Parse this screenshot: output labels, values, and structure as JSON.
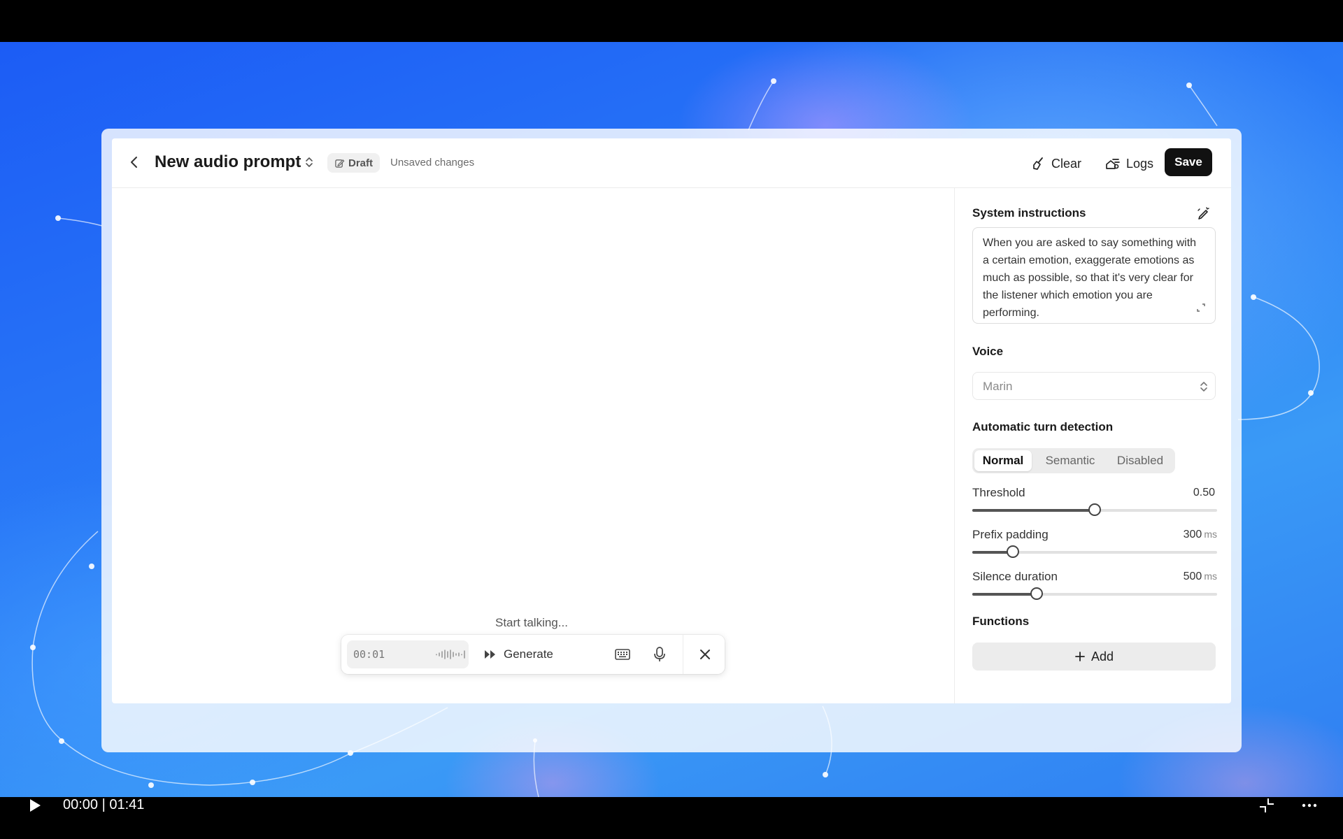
{
  "header": {
    "title": "New audio prompt",
    "draft_label": "Draft",
    "status_text": "Unsaved changes",
    "clear_label": "Clear",
    "logs_label": "Logs",
    "save_label": "Save"
  },
  "canvas": {
    "empty_state": "Start talking..."
  },
  "toolbar": {
    "timer": "00:01",
    "generate_label": "Generate"
  },
  "sidebar": {
    "system_instructions": {
      "label": "System instructions",
      "value": "When you are asked to say something with a certain emotion, exaggerate emotions as much as possible, so that it's very clear for the listener which emotion you are performing."
    },
    "voice": {
      "label": "Voice",
      "value": "Marin"
    },
    "turn_detection": {
      "label": "Automatic turn detection",
      "options": [
        "Normal",
        "Semantic",
        "Disabled"
      ],
      "selected": "Normal"
    },
    "threshold": {
      "label": "Threshold",
      "value_text": "0.50",
      "unit": "",
      "fraction": 0.5
    },
    "prefix_padding": {
      "label": "Prefix padding",
      "value_text": "300",
      "unit": "ms",
      "fraction": 0.167
    },
    "silence_duration": {
      "label": "Silence duration",
      "value_text": "500",
      "unit": "ms",
      "fraction": 0.262
    },
    "functions": {
      "label": "Functions",
      "add_label": "Add"
    }
  },
  "player": {
    "time_display": "00:00 | 01:41"
  },
  "icons": {
    "back": "chevron-left-icon",
    "title_switcher": "chevron-up-down-icon",
    "draft": "edit-icon",
    "clear": "broom-icon",
    "logs": "logs-icon",
    "system_edit": "magic-pen-icon",
    "expand": "expand-icon",
    "voice_select": "chevron-up-down-icon",
    "generate": "fast-forward-icon",
    "keyboard": "keyboard-icon",
    "microphone": "microphone-icon",
    "close": "close-icon",
    "add": "plus-icon",
    "play": "play-icon",
    "collapse": "collapse-icon",
    "more": "more-icon"
  },
  "colors": {
    "accent": "#111111",
    "background_blue": "#2b7df7"
  }
}
